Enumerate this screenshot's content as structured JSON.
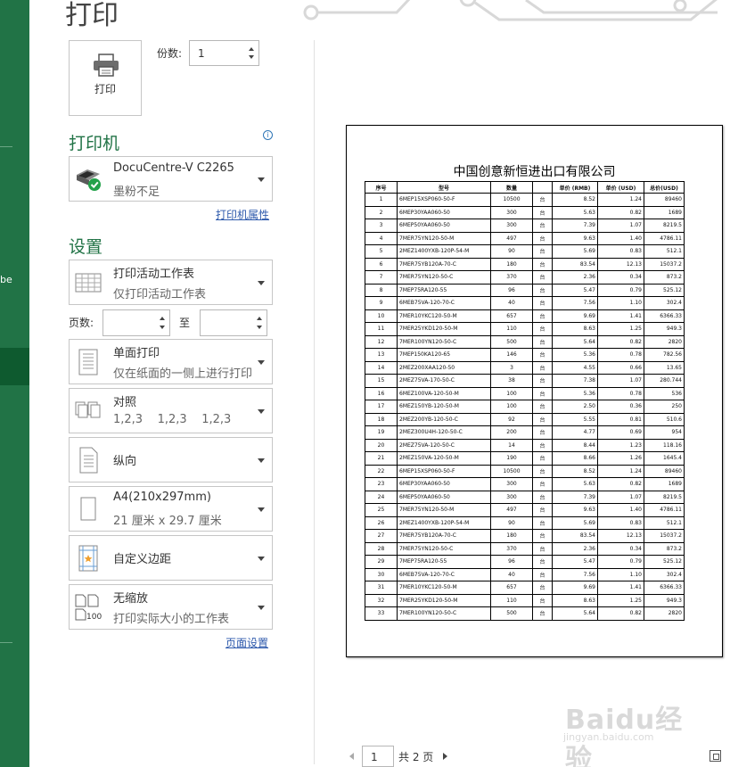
{
  "page_title": "打印",
  "rail": {
    "partial_label": "be"
  },
  "print_button": {
    "label": "打印"
  },
  "copies": {
    "label": "份数:",
    "value": "1"
  },
  "printer": {
    "heading": "打印机",
    "name": "DocuCentre-V C2265",
    "status": "墨粉不足",
    "properties_link": "打印机属性"
  },
  "settings": {
    "heading": "设置",
    "scope": {
      "title": "打印活动工作表",
      "desc": "仅打印活动工作表"
    },
    "pages_label": "页数:",
    "to_label": "至",
    "sides": {
      "title": "单面打印",
      "desc": "仅在纸面的一侧上进行打印"
    },
    "collate": {
      "title": "对照",
      "desc": "1,2,3    1,2,3    1,2,3"
    },
    "orientation": {
      "title": "纵向"
    },
    "paper": {
      "title": "A4(210x297mm)",
      "desc": "21 厘米 x 29.7 厘米"
    },
    "margins": {
      "title": "自定义边距"
    },
    "scaling": {
      "title": "无缩放",
      "desc": "打印实际大小的工作表"
    },
    "page_setup_link": "页面设置"
  },
  "preview": {
    "doc_title": "中国创意新恒进出口有限公司",
    "headers": [
      "序号",
      "型号",
      "数量",
      "",
      "单价 (RMB)",
      "单价 (USD)",
      "总价(USD)"
    ],
    "rows": [
      [
        "1",
        "6MEP15XSP060-50-F",
        "10500",
        "台",
        "8.52",
        "1.24",
        "89460"
      ],
      [
        "2",
        "6MEP30YAA060-50",
        "300",
        "台",
        "5.63",
        "0.82",
        "1689"
      ],
      [
        "3",
        "6MEP50YAA060-50",
        "300",
        "台",
        "7.39",
        "1.07",
        "8219.5"
      ],
      [
        "4",
        "7MER75YN120-50-M",
        "497",
        "台",
        "9.63",
        "1.40",
        "4786.11"
      ],
      [
        "5",
        "2MEZ1400YXB-120P-54-M",
        "90",
        "台",
        "5.69",
        "0.83",
        "512.1"
      ],
      [
        "6",
        "7MER75YB120A-70-C",
        "180",
        "台",
        "83.54",
        "12.13",
        "15037.2"
      ],
      [
        "7",
        "7MER75YN120-50-C",
        "370",
        "台",
        "2.36",
        "0.34",
        "873.2"
      ],
      [
        "8",
        "7MEP75RA120-55",
        "96",
        "台",
        "5.47",
        "0.79",
        "525.12"
      ],
      [
        "9",
        "6MEB75VA-120-70-C",
        "40",
        "台",
        "7.56",
        "1.10",
        "302.4"
      ],
      [
        "10",
        "7MER10YKC120-50-M",
        "657",
        "台",
        "9.69",
        "1.41",
        "6366.33"
      ],
      [
        "11",
        "7MER25YKD120-50-M",
        "110",
        "台",
        "8.63",
        "1.25",
        "949.3"
      ],
      [
        "12",
        "7MER100YN120-50-C",
        "500",
        "台",
        "5.64",
        "0.82",
        "2820"
      ],
      [
        "13",
        "7MEP150KA120-65",
        "146",
        "台",
        "5.36",
        "0.78",
        "782.56"
      ],
      [
        "14",
        "2MEZ200XAA120-50",
        "3",
        "台",
        "4.55",
        "0.66",
        "13.65"
      ],
      [
        "15",
        "2MEZ75VA-170-50-C",
        "38",
        "台",
        "7.38",
        "1.07",
        "280.744"
      ],
      [
        "16",
        "6MEZ100VA-120-50-M",
        "100",
        "台",
        "5.36",
        "0.78",
        "536"
      ],
      [
        "17",
        "6MEZ150YB-120-50-M",
        "100",
        "台",
        "2.50",
        "0.36",
        "250"
      ],
      [
        "18",
        "2MEZ200YB-120-50-C",
        "92",
        "台",
        "5.55",
        "0.81",
        "510.6"
      ],
      [
        "19",
        "2MEZ300U4H-120-50-C",
        "200",
        "台",
        "4.77",
        "0.69",
        "954"
      ],
      [
        "20",
        "2MEZ75VA-120-50-C",
        "14",
        "台",
        "8.44",
        "1.23",
        "118.16"
      ],
      [
        "21",
        "2MEZ150VA-120-50-M",
        "190",
        "台",
        "8.66",
        "1.26",
        "1645.4"
      ],
      [
        "22",
        "6MEP15XSP060-50-F",
        "10500",
        "台",
        "8.52",
        "1.24",
        "89460"
      ],
      [
        "23",
        "6MEP30YAA060-50",
        "300",
        "台",
        "5.63",
        "0.82",
        "1689"
      ],
      [
        "24",
        "6MEP50YAA060-50",
        "300",
        "台",
        "7.39",
        "1.07",
        "8219.5"
      ],
      [
        "25",
        "7MER75YN120-50-M",
        "497",
        "台",
        "9.63",
        "1.40",
        "4786.11"
      ],
      [
        "26",
        "2MEZ1400YXB-120P-54-M",
        "90",
        "台",
        "5.69",
        "0.83",
        "512.1"
      ],
      [
        "27",
        "7MER75YB120A-70-C",
        "180",
        "台",
        "83.54",
        "12.13",
        "15037.2"
      ],
      [
        "28",
        "7MER75YN120-50-C",
        "370",
        "台",
        "2.36",
        "0.34",
        "873.2"
      ],
      [
        "29",
        "7MEP75RA120-55",
        "96",
        "台",
        "5.47",
        "0.79",
        "525.12"
      ],
      [
        "30",
        "6MEB75VA-120-70-C",
        "40",
        "台",
        "7.56",
        "1.10",
        "302.4"
      ],
      [
        "31",
        "7MER10YKC120-50-M",
        "657",
        "台",
        "9.69",
        "1.41",
        "6366.33"
      ],
      [
        "32",
        "7MER25YKD120-50-M",
        "110",
        "台",
        "8.63",
        "1.25",
        "949.3"
      ],
      [
        "33",
        "7MER100YN120-50-C",
        "500",
        "台",
        "5.64",
        "0.82",
        "2820"
      ]
    ]
  },
  "pager": {
    "current": "1",
    "total": "共 2 页"
  },
  "watermark": {
    "logo": "Baidu经验",
    "url": "jingyan.baidu.com"
  },
  "colors": {
    "accent": "#217346",
    "link": "#2e5aac"
  },
  "icons": [
    "printer-icon",
    "info-icon",
    "printer-device-icon",
    "sheet-grid-icon",
    "one-sided-icon",
    "collate-icon",
    "portrait-icon",
    "paper-size-icon",
    "margins-icon",
    "scaling-icon",
    "spinner-icon",
    "chevron-down-icon",
    "prev-page-icon",
    "next-page-icon",
    "zoom-to-page-icon"
  ]
}
